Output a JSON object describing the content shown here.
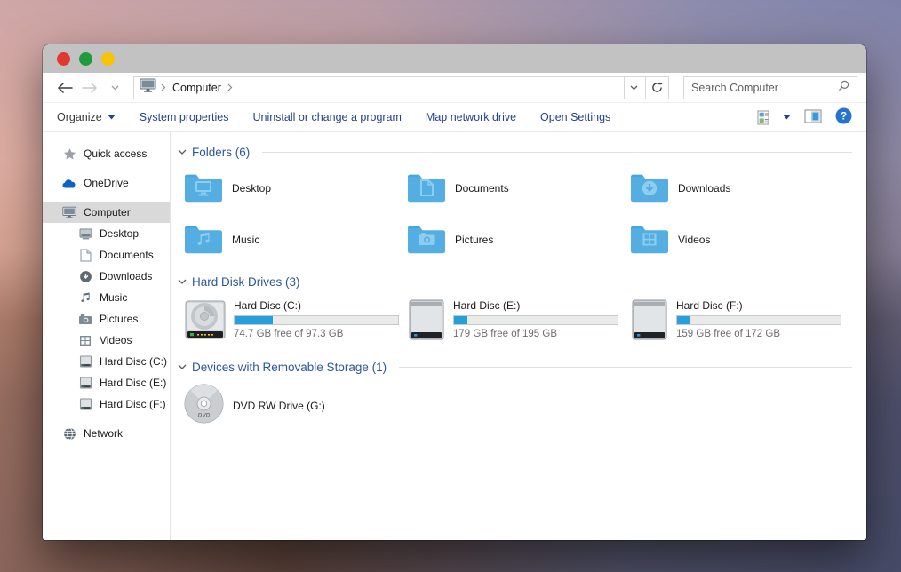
{
  "titlebar": {
    "buttons": [
      {
        "name": "close",
        "color": "#e1382f"
      },
      {
        "name": "minimize",
        "color": "#1f9a3f"
      },
      {
        "name": "zoom",
        "color": "#f6c500"
      }
    ]
  },
  "navbar": {
    "breadcrumb": {
      "root_icon": "computer",
      "items": [
        "Computer"
      ]
    },
    "search": {
      "placeholder": "Search Computer"
    }
  },
  "toolbar": {
    "organize": {
      "label": "Organize"
    },
    "links": [
      "System properties",
      "Uninstall or change a program",
      "Map network drive",
      "Open Settings"
    ],
    "right_icons": [
      "views",
      "preview-pane",
      "help"
    ]
  },
  "sidebar": {
    "items": [
      {
        "label": "Quick access",
        "icon": "star",
        "level": 0,
        "selected": false,
        "gap": false
      },
      {
        "label": "OneDrive",
        "icon": "onedrive",
        "level": 0,
        "selected": false,
        "gap": true
      },
      {
        "label": "Computer",
        "icon": "computer",
        "level": 0,
        "selected": true,
        "gap": true
      },
      {
        "label": "Desktop",
        "icon": "desktop",
        "level": 1,
        "selected": false,
        "gap": false
      },
      {
        "label": "Documents",
        "icon": "documents",
        "level": 1,
        "selected": false,
        "gap": false
      },
      {
        "label": "Downloads",
        "icon": "downloads",
        "level": 1,
        "selected": false,
        "gap": false
      },
      {
        "label": "Music",
        "icon": "music",
        "level": 1,
        "selected": false,
        "gap": false
      },
      {
        "label": "Pictures",
        "icon": "pictures",
        "level": 1,
        "selected": false,
        "gap": false
      },
      {
        "label": "Videos",
        "icon": "videos",
        "level": 1,
        "selected": false,
        "gap": false
      },
      {
        "label": "Hard Disc (C:)",
        "icon": "harddisk",
        "level": 1,
        "selected": false,
        "gap": false
      },
      {
        "label": "Hard Disc (E:)",
        "icon": "harddisk",
        "level": 1,
        "selected": false,
        "gap": false
      },
      {
        "label": "Hard Disc (F:)",
        "icon": "harddisk",
        "level": 1,
        "selected": false,
        "gap": false
      },
      {
        "label": "Network",
        "icon": "network",
        "level": 0,
        "selected": false,
        "gap": true
      }
    ]
  },
  "main": {
    "sections": [
      {
        "title": "Folders (6)",
        "items": [
          {
            "label": "Desktop",
            "icon": "folder-desktop"
          },
          {
            "label": "Documents",
            "icon": "folder-documents"
          },
          {
            "label": "Downloads",
            "icon": "folder-downloads"
          },
          {
            "label": "Music",
            "icon": "folder-music"
          },
          {
            "label": "Pictures",
            "icon": "folder-pictures"
          },
          {
            "label": "Videos",
            "icon": "folder-videos"
          }
        ]
      },
      {
        "title": "Hard Disk Drives (3)",
        "items": [
          {
            "label": "Hard Disc (C:)",
            "icon": "hdd-open",
            "free_text": "74.7 GB free of 97.3 GB",
            "used_percent": 23.2
          },
          {
            "label": "Hard Disc (E:)",
            "icon": "hdd",
            "free_text": "179 GB free of 195 GB",
            "used_percent": 8.2
          },
          {
            "label": "Hard Disc (F:)",
            "icon": "hdd",
            "free_text": "159 GB free of 172 GB",
            "used_percent": 7.6
          }
        ]
      },
      {
        "title": "Devices with Removable Storage (1)",
        "items": [
          {
            "label": "DVD RW Drive (G:)",
            "icon": "dvd"
          }
        ]
      }
    ]
  },
  "colors": {
    "accent_blue": "#2b579a",
    "toolbar_link_blue": "#26418f",
    "progress_fill": "#26a0da",
    "folder_blue": "#55aee2",
    "selection_gray": "#d9d9d9",
    "titlebar_gray": "#c2c2c2"
  }
}
